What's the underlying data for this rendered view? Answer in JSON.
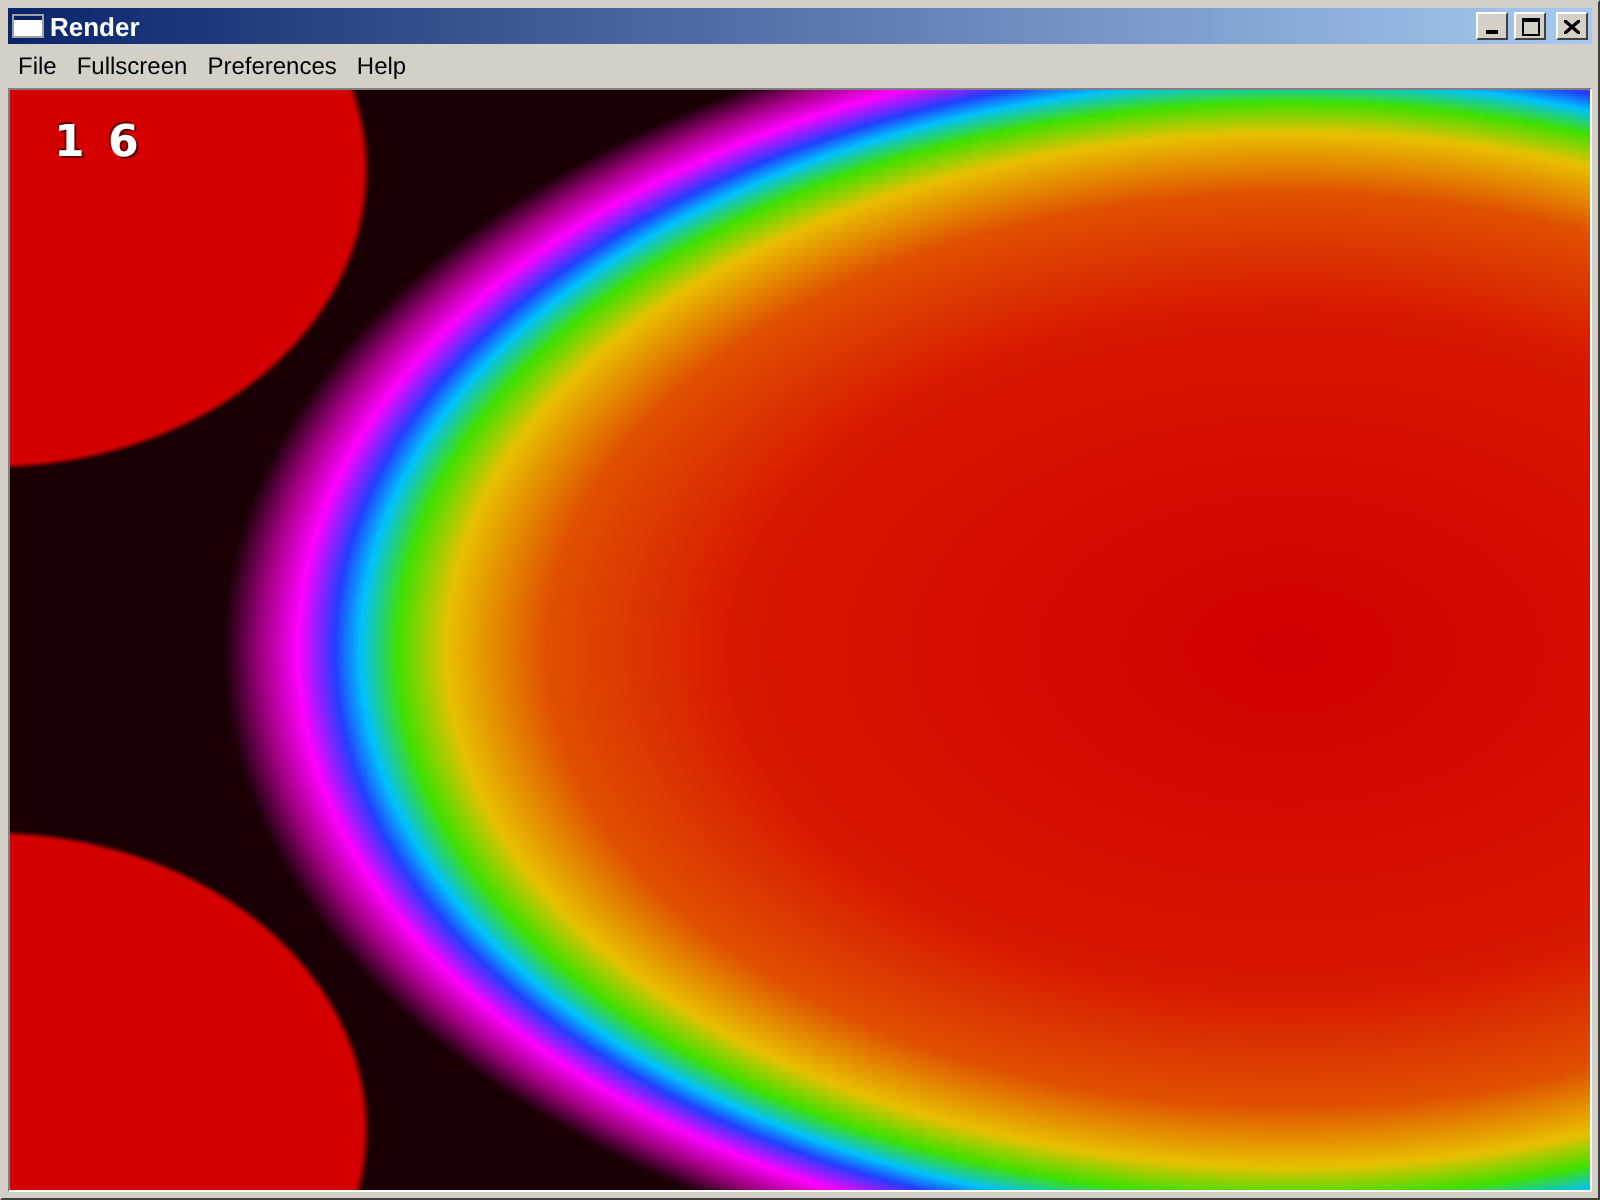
{
  "window": {
    "title": "Render"
  },
  "menu": [
    "File",
    "Fullscreen",
    "Preferences",
    "Help"
  ],
  "canvas": {
    "counter": "1 6"
  }
}
